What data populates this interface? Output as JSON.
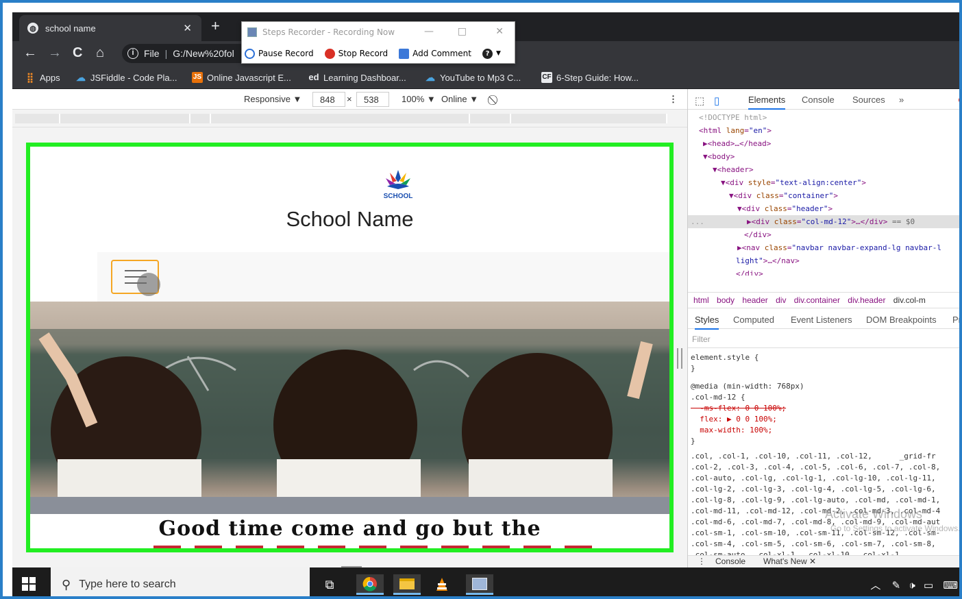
{
  "browser": {
    "tab_title": "school name",
    "tab_close": "✕",
    "new_tab": "+",
    "address_scheme": "File",
    "address_path": "G:/New%20fol",
    "nav": {
      "back": "←",
      "forward": "→",
      "reload": "C",
      "home": "⌂"
    }
  },
  "bookmarks": [
    {
      "label": "Apps",
      "icon": "apps-grid-icon",
      "color": "#f28b25"
    },
    {
      "label": "JSFiddle - Code Pla...",
      "icon": "jsfiddle-icon",
      "color": "#4aa3df"
    },
    {
      "label": "Online Javascript E...",
      "icon": "js-icon",
      "color": "#e8710a"
    },
    {
      "label": "Learning Dashboar...",
      "icon": "ed-icon",
      "color": "#e8eaed"
    },
    {
      "label": "YouTube to Mp3 C...",
      "icon": "cloud-icon",
      "color": "#4aa3df"
    },
    {
      "label": "6-Step Guide: How...",
      "icon": "cf-icon",
      "color": "#e8eaed"
    }
  ],
  "steps_recorder": {
    "title": "Steps Recorder - Recording Now",
    "pause": "Pause Record",
    "stop": "Stop Record",
    "add_comment": "Add Comment",
    "help": "?"
  },
  "device_bar": {
    "mode": "Responsive ▼",
    "width": "848",
    "times": "×",
    "height": "538",
    "zoom": "100% ▼",
    "network": "Online ▼"
  },
  "site": {
    "logo_text": "SCHOOL",
    "title": "School Name",
    "quote": "Good time come and go but the"
  },
  "devtools": {
    "tabs": [
      "Elements",
      "Console",
      "Sources",
      "»"
    ],
    "dom_lines": [
      {
        "indent": 0,
        "text": "<!DOCTYPE html>"
      },
      {
        "indent": 0,
        "text": "<html lang=\"en\">"
      },
      {
        "indent": 1,
        "text": "▶<head>…</head>"
      },
      {
        "indent": 1,
        "text": "▼<body>"
      },
      {
        "indent": 2,
        "text": "▼<header>"
      },
      {
        "indent": 3,
        "text": "▼<div style=\"text-align:center\">"
      },
      {
        "indent": 4,
        "text": "▼<div class=\"container\">"
      },
      {
        "indent": 5,
        "text": "▼<div class=\"header\">"
      },
      {
        "indent": 6,
        "text": "▶<div class=\"col-md-12\">…</div> == $0"
      },
      {
        "indent": 5,
        "text": "</div>"
      },
      {
        "indent": 5,
        "text": "▶<nav class=\"navbar navbar-expand-lg navbar-l"
      },
      {
        "indent": 5,
        "text": "light\">…</nav>"
      },
      {
        "indent": 4,
        "text": "</div>"
      }
    ],
    "ellipsis": "...",
    "breadcrumbs": [
      "html",
      "body",
      "header",
      "div",
      "div.container",
      "div.header",
      "div.col-m"
    ],
    "style_tabs": [
      "Styles",
      "Computed",
      "Event Listeners",
      "DOM Breakpoints",
      "Pro"
    ],
    "filter_placeholder": "Filter",
    "css_lines": [
      "element.style {",
      "}",
      "@media (min-width: 768px)",
      ".col-md-12 {",
      "  -ms-flex: 0 0 100%;",
      "  flex: ▶ 0 0 100%;",
      "  max-width: 100%;",
      "}",
      ".col, .col-1, .col-10, .col-11, .col-12,      _grid-fr",
      ".col-2, .col-3, .col-4, .col-5, .col-6, .col-7, .col-8,",
      ".col-auto, .col-lg, .col-lg-1, .col-lg-10, .col-lg-11,",
      ".col-lg-2, .col-lg-3, .col-lg-4, .col-lg-5, .col-lg-6,",
      ".col-lg-8, .col-lg-9, .col-lg-auto, .col-md, .col-md-1,",
      ".col-md-11, .col-md-12, .col-md-2, .col-md-3, .col-md-4",
      ".col-md-6, .col-md-7, .col-md-8, .col-md-9, .col-md-aut",
      ".col-sm-1, .col-sm-10, .col-sm-11, .col-sm-12, .col-sm-",
      ".col-sm-4, .col-sm-5, .col-sm-6, .col-sm-7, .col-sm-8,",
      ".col-sm-auto, .col-xl-1, .col-xl-10, .col-xl-1"
    ],
    "drawer": {
      "console": "Console",
      "whats_new": "What's New ✕",
      "menu": "⋮"
    },
    "watermark": "Activate Windows",
    "watermark_sub": "Go to Settings to activate Windows."
  },
  "taskbar": {
    "search_placeholder": "Type here to search",
    "apps": [
      "task-view-icon",
      "chrome-icon",
      "file-explorer-icon",
      "vlc-icon",
      "steps-recorder-icon"
    ]
  }
}
